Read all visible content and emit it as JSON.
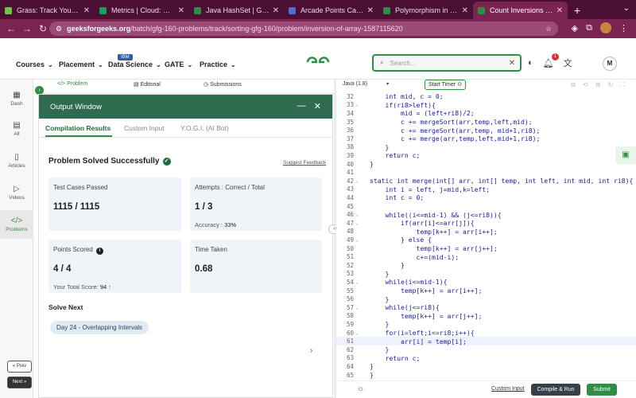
{
  "browser": {
    "tabs": [
      {
        "title": "Grass: Track Your Rewa",
        "favicon": "#6fc44a",
        "active": false
      },
      {
        "title": "Metrics | Cloud: Mongo",
        "favicon": "#18a058",
        "active": false
      },
      {
        "title": "Java HashSet | Geeksfo",
        "favicon": "#2f8d46",
        "active": false
      },
      {
        "title": "Arcade Points Calculato",
        "favicon": "#4a6fd1",
        "active": false
      },
      {
        "title": "Polymorphism in Java |",
        "favicon": "#2f8d46",
        "active": false
      },
      {
        "title": "Count Inversions | Prac",
        "favicon": "#2f8d46",
        "active": true
      }
    ],
    "url_host": "geeksforgeeks.org",
    "url_path": "/batch/gfg-160-problems/track/sorting-gfg-160/problem/inversion-of-array-1587115620"
  },
  "header": {
    "menu": [
      {
        "label": "Courses"
      },
      {
        "label": "Placement"
      },
      {
        "label": "Data Science"
      },
      {
        "label": "GATE"
      },
      {
        "label": "Practice"
      }
    ],
    "ibm_badge": "IBM",
    "search_placeholder": "Search...",
    "notification_count": "1",
    "user_initial": "M"
  },
  "rail": {
    "items": [
      {
        "label": "Dash",
        "icon": "dashboard-icon"
      },
      {
        "label": "All",
        "icon": "list-icon"
      },
      {
        "label": "Articles",
        "icon": "article-icon"
      },
      {
        "label": "Videos",
        "icon": "video-icon"
      },
      {
        "label": "Problems",
        "icon": "code-icon"
      }
    ],
    "prev": "« Prev",
    "next": "Next »"
  },
  "problem_tabs": {
    "problem": "Problem",
    "editorial": "Editorial",
    "submissions": "Submissions"
  },
  "output": {
    "title": "Output Window",
    "tabs": [
      "Compilation Results",
      "Custom Input",
      "Y.O.G.I. (AI Bot)"
    ],
    "status": "Problem Solved Successfully",
    "feedback": "Suggest Feedback",
    "test_cases_label": "Test Cases Passed",
    "test_cases_value": "1115 / 1115",
    "attempts_label": "Attempts : Correct / Total",
    "attempts_value": "1 / 3",
    "accuracy_label": "Accuracy :",
    "accuracy_value": "33%",
    "points_label": "Points Scored",
    "points_value": "4 / 4",
    "total_score_label": "Your Total Score:",
    "total_score_value": "94",
    "time_label": "Time Taken",
    "time_value": "0.68",
    "solve_next": "Solve Next",
    "next_problem": "Day 24 - Overlapping Intervals"
  },
  "editor": {
    "language": "Java (1.8)",
    "timer": "Start Timer",
    "lines": [
      {
        "n": "32",
        "code": "    int mid, c = 0;",
        "fold": false
      },
      {
        "n": "33",
        "code": "    if(ri8>left){",
        "fold": true
      },
      {
        "n": "34",
        "code": "        mid = (left+ri8)/2;",
        "fold": false
      },
      {
        "n": "35",
        "code": "        c += mergeSort(arr,temp,left,mid);",
        "fold": false
      },
      {
        "n": "36",
        "code": "        c += mergeSort(arr,temp, mid+1,ri8);",
        "fold": false
      },
      {
        "n": "37",
        "code": "        c += merge(arr,temp,left,mid+1,ri8);",
        "fold": false
      },
      {
        "n": "38",
        "code": "    }",
        "fold": false
      },
      {
        "n": "39",
        "code": "    return c;",
        "fold": false
      },
      {
        "n": "40",
        "code": "}",
        "fold": false
      },
      {
        "n": "41",
        "code": "",
        "fold": false
      },
      {
        "n": "42",
        "code": "static int merge(int[] arr, int[] temp, int left, int mid, int ri8){",
        "fold": true
      },
      {
        "n": "43",
        "code": "    int i = left, j=mid,k=left;",
        "fold": false
      },
      {
        "n": "44",
        "code": "    int c = 0;",
        "fold": false
      },
      {
        "n": "45",
        "code": "",
        "fold": false
      },
      {
        "n": "46",
        "code": "    while((i<=mid-1) && (j<=ri8)){",
        "fold": true
      },
      {
        "n": "47",
        "code": "        if(arr[i]<=arr[j]){",
        "fold": true
      },
      {
        "n": "48",
        "code": "            temp[k++] = arr[i++];",
        "fold": false
      },
      {
        "n": "49",
        "code": "        } else {",
        "fold": true
      },
      {
        "n": "50",
        "code": "            temp[k++] = arr[j++];",
        "fold": false
      },
      {
        "n": "51",
        "code": "            c+=(mid-i);",
        "fold": false
      },
      {
        "n": "52",
        "code": "        }",
        "fold": false
      },
      {
        "n": "53",
        "code": "    }",
        "fold": false
      },
      {
        "n": "54",
        "code": "    while(i<=mid-1){",
        "fold": true
      },
      {
        "n": "55",
        "code": "        temp[k++] = arr[i++];",
        "fold": false
      },
      {
        "n": "56",
        "code": "    }",
        "fold": false
      },
      {
        "n": "57",
        "code": "    while(j<=ri8){",
        "fold": true
      },
      {
        "n": "58",
        "code": "        temp[k++] = arr[j++];",
        "fold": false
      },
      {
        "n": "59",
        "code": "    }",
        "fold": false
      },
      {
        "n": "60",
        "code": "    for(i=left;i<=ri8;i++){",
        "fold": true
      },
      {
        "n": "61",
        "code": "        arr[i] = temp[i];",
        "fold": false,
        "highlight": true
      },
      {
        "n": "62",
        "code": "    }",
        "fold": false
      },
      {
        "n": "63",
        "code": "    return c;",
        "fold": false
      },
      {
        "n": "64",
        "code": "}",
        "fold": false
      },
      {
        "n": "65",
        "code": "}",
        "fold": false
      }
    ],
    "custom_input": "Custom Input",
    "compile_run": "Compile & Run",
    "submit": "Submit"
  }
}
